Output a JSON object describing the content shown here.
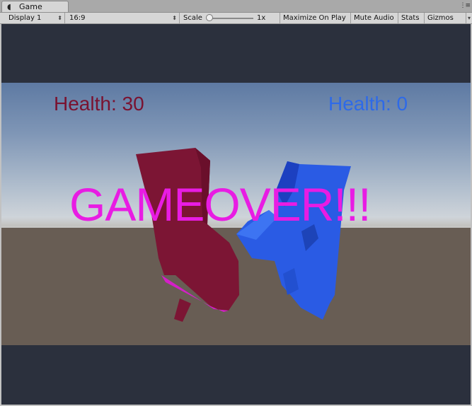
{
  "window": {
    "tab_label": "Game",
    "tab_icon": "game-controller-icon",
    "menu_icon": "menu-dots-icon"
  },
  "toolbar": {
    "display": "Display 1",
    "aspect": "16:9",
    "scale_label": "Scale",
    "scale_value": "1x",
    "scale_level": 0,
    "maximize_on_play": "Maximize On Play",
    "mute_audio": "Mute Audio",
    "stats": "Stats",
    "gizmos": "Gizmos"
  },
  "game": {
    "player1_health": "Health: 30",
    "player2_health": "Health: 0",
    "status": "GAMEOVER!!!",
    "colors": {
      "player1": "#7a1230",
      "player2": "#2e6ae8",
      "gameover": "#e81ce3",
      "letterbox": "#2b303d",
      "ground": "#685d54"
    }
  }
}
